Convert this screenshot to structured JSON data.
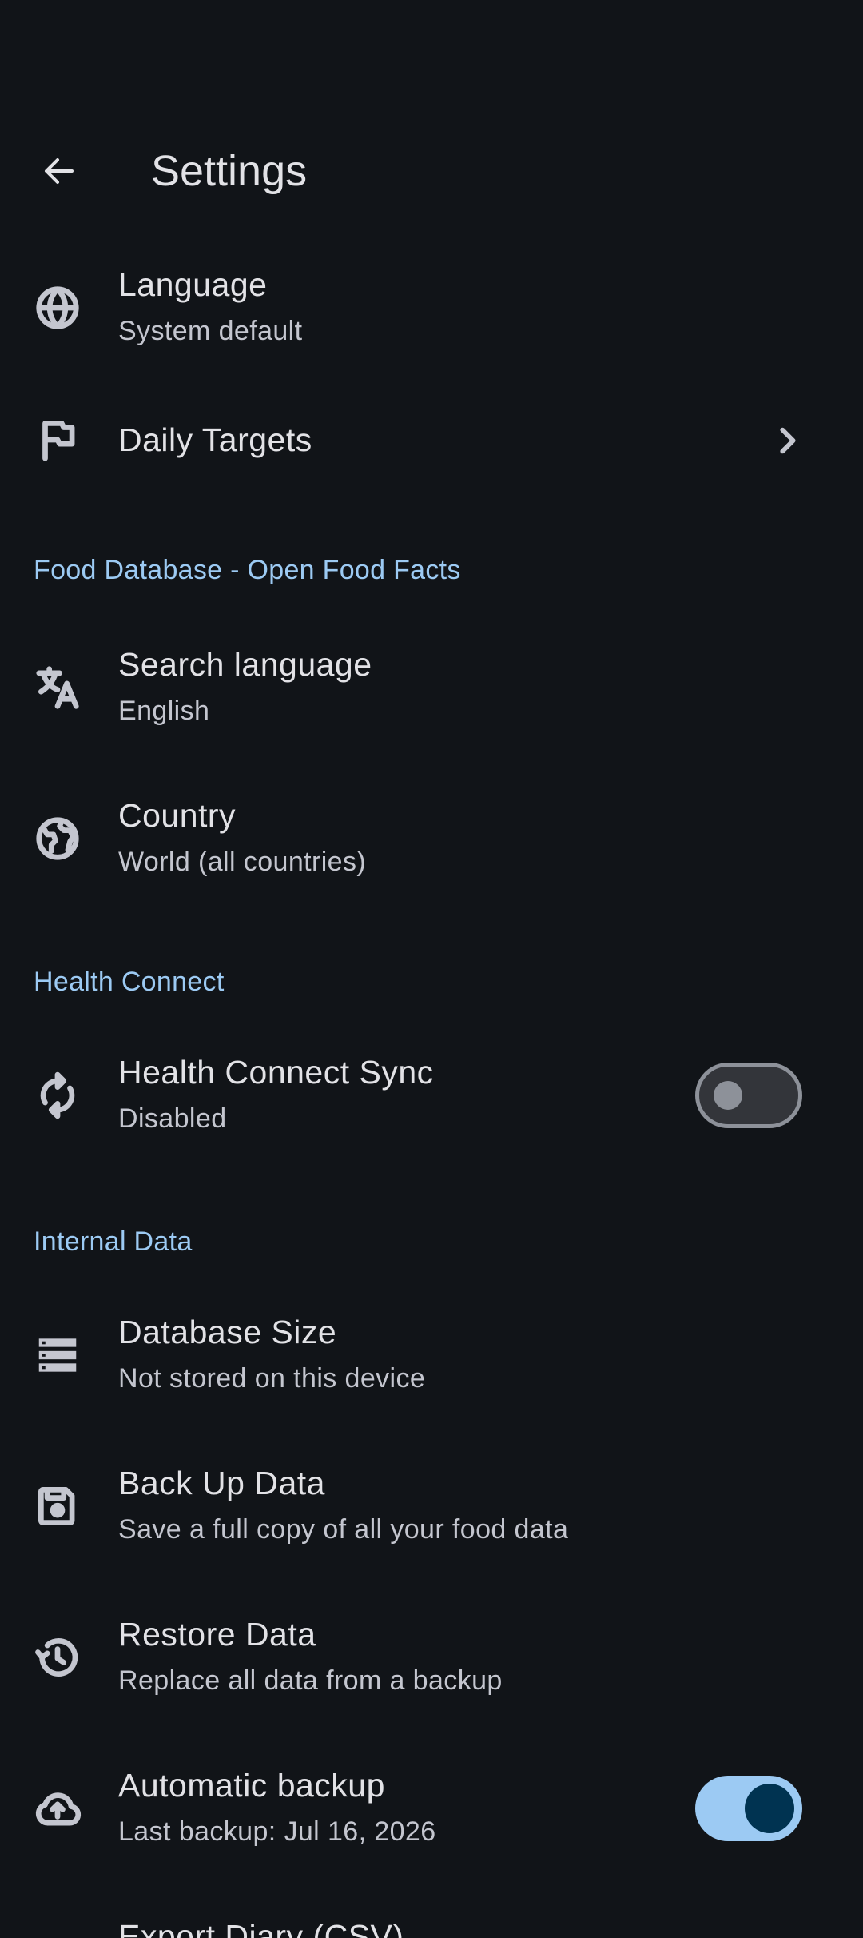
{
  "appbar": {
    "title": "Settings"
  },
  "general": [
    {
      "icon": "globe-icon",
      "title": "Language",
      "subtitle": "System default"
    },
    {
      "icon": "flag-icon",
      "title": "Daily Targets"
    }
  ],
  "sections": {
    "food_db": "Food Database - Open Food Facts",
    "health": "Health Connect",
    "internal": "Internal Data"
  },
  "food_db": [
    {
      "icon": "translate-icon",
      "title": "Search language",
      "subtitle": "English"
    },
    {
      "icon": "public-globe-icon",
      "title": "Country",
      "subtitle": "World (all countries)"
    }
  ],
  "health": [
    {
      "icon": "sync-icon",
      "title": "Health Connect Sync",
      "subtitle": "Disabled",
      "toggle": false
    }
  ],
  "internal": [
    {
      "icon": "storage-icon",
      "title": "Database Size",
      "subtitle": "Not stored on this device"
    },
    {
      "icon": "save-icon",
      "title": "Back Up Data",
      "subtitle": "Save a full copy of all your food data"
    },
    {
      "icon": "restore-icon",
      "title": "Restore Data",
      "subtitle": "Replace all data from a backup"
    },
    {
      "icon": "cloud-upload-icon",
      "title": "Automatic backup",
      "subtitle": "Last backup: Jul 16, 2026",
      "toggle": true
    },
    {
      "title": "Export Diary (CSV)"
    }
  ]
}
